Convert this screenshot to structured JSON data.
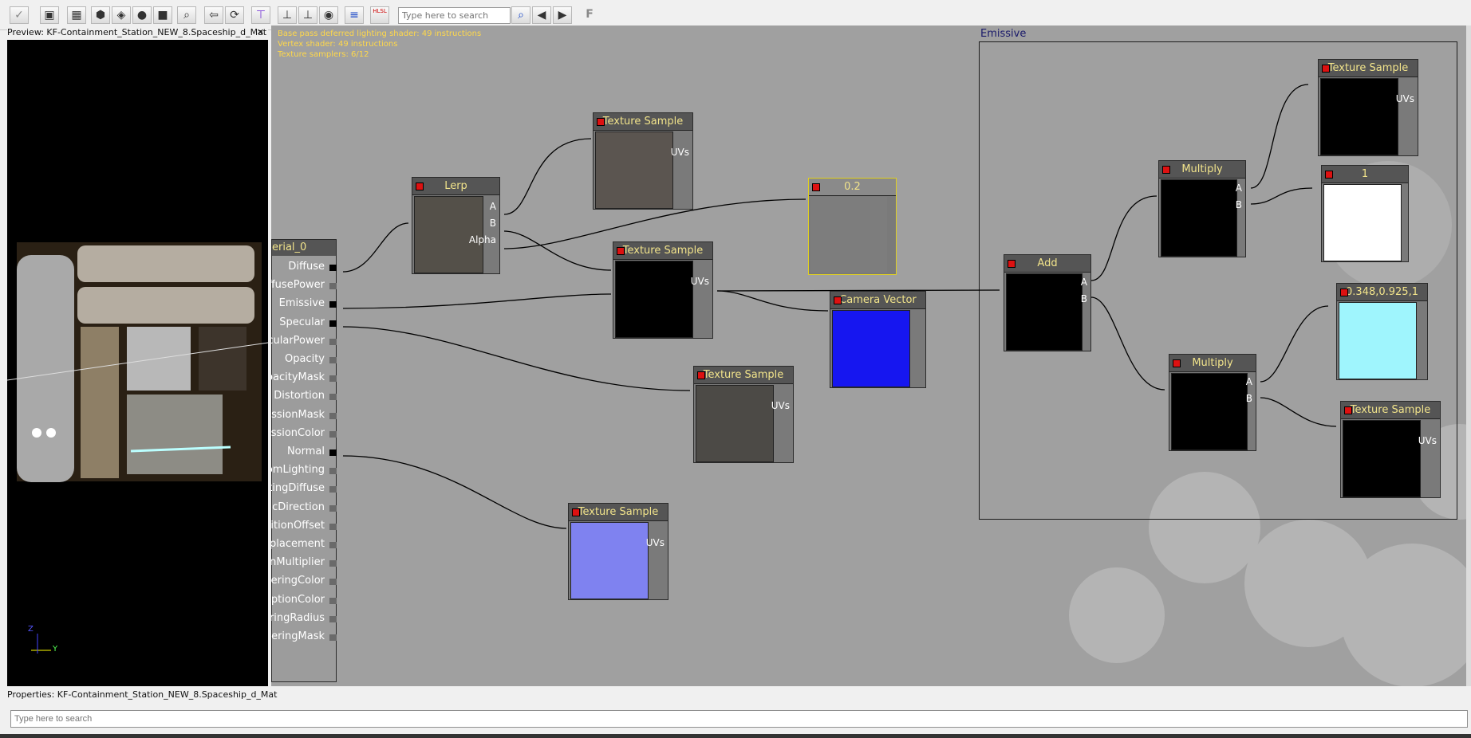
{
  "toolbar": {
    "search_placeholder": "Type here to search",
    "hlsl_label": "HLSL",
    "f_label": "F"
  },
  "preview": {
    "title": "Preview: KF-Containment_Station_NEW_8.Spaceship_d_Mat",
    "close": "✕",
    "axis_z": "Z",
    "axis_y": "Y"
  },
  "canvas": {
    "stats": [
      "Base pass deferred lighting shader: 49 instructions",
      "Vertex shader: 49 instructions",
      "Texture samplers: 6/12"
    ],
    "emissive_comment": "Emissive"
  },
  "material_node": {
    "title": "erial_0",
    "inputs": [
      "Diffuse",
      "DiffusePower",
      "Emissive",
      "Specular",
      "SpecularPower",
      "Opacity",
      "OpacityMask",
      "Distortion",
      "TransmissionMask",
      "TransmissionColor",
      "Normal",
      "CustomLighting",
      "CustomLightingDiffuse",
      "AnisotropicDirection",
      "WorldPositionOffset",
      "Displacement",
      "TessellationMultiplier",
      "SubsurfaceInscatteringColor",
      "SubsurfaceAbsorptionColor",
      "SubsurfaceScatteringRadius",
      "SubsurfaceScatteringMask"
    ],
    "visible_labels": [
      "Diffuse",
      "iffusePower",
      "Emissive",
      "Specular",
      "ecularPower",
      "Opacity",
      "OpacityMask",
      "Distortion",
      "missionMask",
      "missionColor",
      "Normal",
      "stomLighting",
      "ghtingDiffuse",
      "opicDirection",
      "sitionOffset",
      "isplacement",
      "tionMultiplier",
      "tteringColor",
      "orptionColor",
      "teringRadius",
      "tteringMask"
    ]
  },
  "nodes": {
    "lerp": {
      "title": "Lerp",
      "a": "A",
      "b": "B",
      "alpha": "Alpha"
    },
    "tex1": {
      "title": "Texture Sample",
      "uvs": "UVs"
    },
    "tex2": {
      "title": "Texture Sample",
      "uvs": "UVs"
    },
    "tex3": {
      "title": "Texture Sample",
      "uvs": "UVs"
    },
    "tex4": {
      "title": "Texture Sample",
      "uvs": "UVs"
    },
    "tex5": {
      "title": "Texture Sample",
      "uvs": "UVs"
    },
    "tex6": {
      "title": "Texture Sample",
      "uvs": "UVs"
    },
    "const02": {
      "title": "0.2"
    },
    "camera_vector": {
      "title": "Camera Vector"
    },
    "add": {
      "title": "Add",
      "a": "A",
      "b": "B"
    },
    "multiply1": {
      "title": "Multiply",
      "a": "A",
      "b": "B"
    },
    "multiply2": {
      "title": "Multiply",
      "a": "A",
      "b": "B"
    },
    "const1": {
      "title": "1"
    },
    "vec_color": {
      "title": "0.348,0.925,1"
    }
  },
  "properties": {
    "title": "Properties: KF-Containment_Station_NEW_8.Spaceship_d_Mat",
    "search_placeholder": "Type here to search"
  },
  "colors": {
    "canvas_bg": "#a0a0a0",
    "node_title_text": "#f2e48b",
    "camera_vector_preview": "#1616f0",
    "vec_color_preview": "#9ff5fd",
    "normal_map_preview": "#7f82f0",
    "const_white_preview": "#ffffff",
    "const02_preview": "#7d7d7d",
    "stats_text": "#ffd84a"
  }
}
